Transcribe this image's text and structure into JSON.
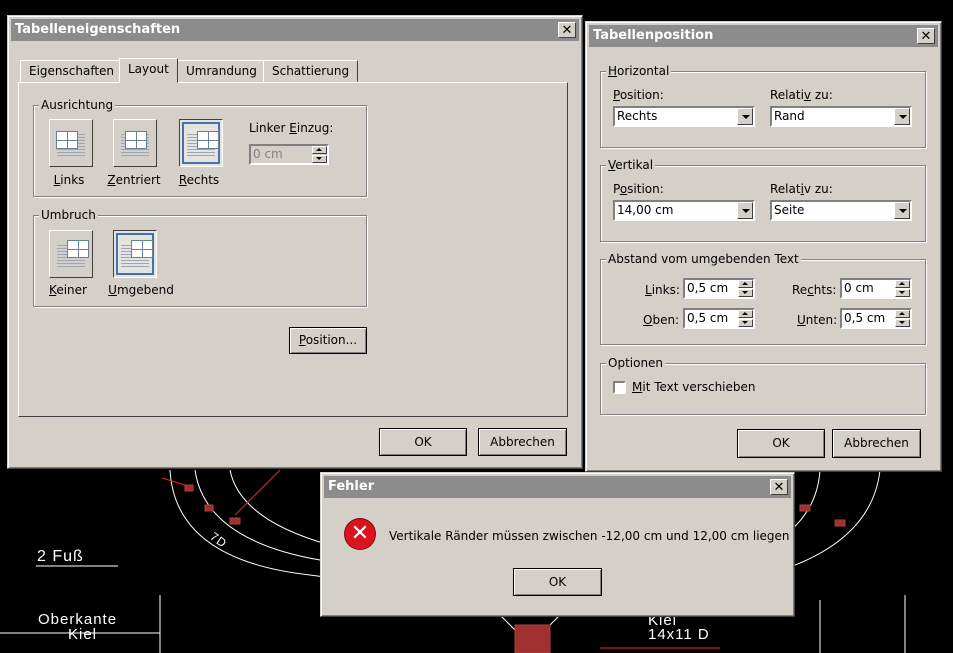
{
  "cad": {
    "texts": [
      "2 Fuß",
      "Oberkante",
      "Kiel",
      "Kiel",
      "14x11 D",
      "7D"
    ]
  },
  "table_properties": {
    "title": "Tabelleneigenschaften",
    "close": "✕",
    "tabs": [
      {
        "label": "Eigenschaften"
      },
      {
        "label": "Layout",
        "active": true
      },
      {
        "label": "Umrandung"
      },
      {
        "label": "Schattierung"
      }
    ],
    "alignment_group": "Ausrichtung",
    "alignment_options": [
      {
        "label_pre": "",
        "mnemonic": "L",
        "label_post": "inks",
        "selected": false
      },
      {
        "label_pre": "",
        "mnemonic": "Z",
        "label_post": "entriert",
        "selected": false
      },
      {
        "label_pre": "",
        "mnemonic": "R",
        "label_post": "echts",
        "selected": true
      }
    ],
    "indent_label_pre": "Linker ",
    "indent_mnemonic": "E",
    "indent_label_post": "inzug:",
    "indent_value": "0 cm",
    "wrap_group": "Umbruch",
    "wrap_options": [
      {
        "label_pre": "",
        "mnemonic": "K",
        "label_post": "einer",
        "selected": false
      },
      {
        "label_pre": "",
        "mnemonic": "U",
        "label_post": "mgebend",
        "selected": true
      }
    ],
    "position_btn_pre": "",
    "position_btn_mnemonic": "P",
    "position_btn_post": "osition...",
    "ok": "OK",
    "cancel": "Abbrechen"
  },
  "table_position": {
    "title": "Tabellenposition",
    "close": "✕",
    "horizontal_group_mnemonic": "H",
    "horizontal_group_rest": "orizontal",
    "h_position_label_pre": "",
    "h_position_label_mnemonic": "P",
    "h_position_label_post": "osition:",
    "h_position_value": "Rechts",
    "h_relative_label_pre": "Relati",
    "h_relative_label_mnemonic": "v",
    "h_relative_label_post": " zu:",
    "h_relative_value": "Rand",
    "vertical_group_mnemonic": "V",
    "vertical_group_rest": "ertikal",
    "v_position_label_pre": "P",
    "v_position_label_mnemonic": "o",
    "v_position_label_post": "sition:",
    "v_position_value": "14,00 cm",
    "v_relative_label_pre": "Relat",
    "v_relative_label_mnemonic": "i",
    "v_relative_label_post": "v zu:",
    "v_relative_value": "Seite",
    "distance_group": "Abstand vom umgebenden Text",
    "left_label_pre": "",
    "left_label_mnemonic": "L",
    "left_label_post": "inks:",
    "left_value": "0,5 cm",
    "right_label_pre": "Re",
    "right_label_mnemonic": "c",
    "right_label_post": "hts:",
    "right_value": "0 cm",
    "top_label_pre": "",
    "top_label_mnemonic": "O",
    "top_label_post": "ben:",
    "top_value": "0,5 cm",
    "bottom_label_pre": "",
    "bottom_label_mnemonic": "U",
    "bottom_label_post": "nten:",
    "bottom_value": "0,5 cm",
    "options_group": "Optionen",
    "move_with_text_pre": "",
    "move_with_text_mnemonic": "M",
    "move_with_text_post": "it Text verschieben",
    "move_with_text_checked": false,
    "ok": "OK",
    "cancel": "Abbrechen"
  },
  "error_dialog": {
    "title": "Fehler",
    "close": "✕",
    "icon": "error-icon",
    "icon_glyph": "✕",
    "message": "Vertikale Ränder müssen zwischen -12,00 cm und 12,00 cm liegen",
    "ok": "OK"
  }
}
